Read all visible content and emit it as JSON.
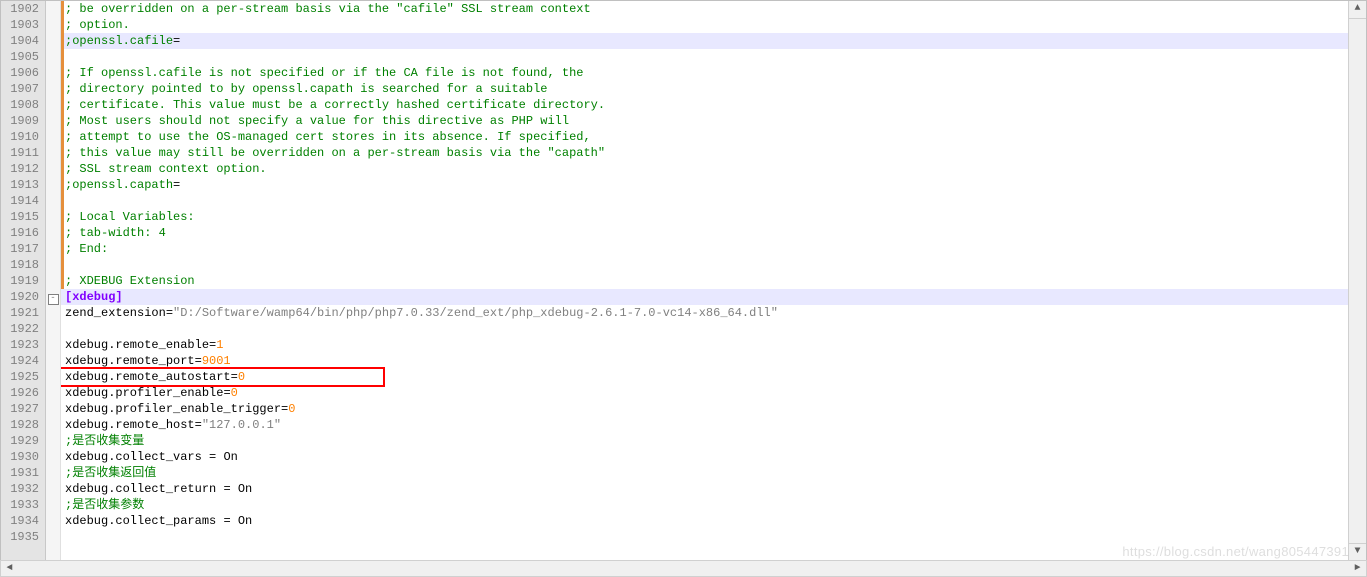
{
  "gutter_start": 1902,
  "lines": [
    {
      "n": 1902,
      "type": "comment",
      "text": "; be overridden on a per-stream basis via the \"cafile\" SSL stream context",
      "orange": true
    },
    {
      "n": 1903,
      "type": "comment",
      "text": "; option.",
      "orange": true
    },
    {
      "n": 1904,
      "type": "raw",
      "html": "<span class='comment'>;openssl.cafile</span><span class='op'>=</span>",
      "hl": true,
      "orange": true
    },
    {
      "n": 1905,
      "type": "blank",
      "text": "",
      "orange": true
    },
    {
      "n": 1906,
      "type": "comment",
      "text": "; If openssl.cafile is not specified or if the CA file is not found, the",
      "orange": true
    },
    {
      "n": 1907,
      "type": "comment",
      "text": "; directory pointed to by openssl.capath is searched for a suitable",
      "orange": true
    },
    {
      "n": 1908,
      "type": "comment",
      "text": "; certificate. This value must be a correctly hashed certificate directory.",
      "orange": true
    },
    {
      "n": 1909,
      "type": "comment",
      "text": "; Most users should not specify a value for this directive as PHP will",
      "orange": true
    },
    {
      "n": 1910,
      "type": "comment",
      "text": "; attempt to use the OS-managed cert stores in its absence. If specified,",
      "orange": true
    },
    {
      "n": 1911,
      "type": "comment",
      "text": "; this value may still be overridden on a per-stream basis via the \"capath\"",
      "orange": true
    },
    {
      "n": 1912,
      "type": "comment",
      "text": "; SSL stream context option.",
      "orange": true
    },
    {
      "n": 1913,
      "type": "raw",
      "html": "<span class='comment'>;openssl.capath</span><span class='op'>=</span>",
      "orange": true
    },
    {
      "n": 1914,
      "type": "blank",
      "text": "",
      "orange": true
    },
    {
      "n": 1915,
      "type": "comment",
      "text": "; Local Variables:",
      "orange": true
    },
    {
      "n": 1916,
      "type": "comment",
      "text": "; tab-width: 4",
      "orange": true
    },
    {
      "n": 1917,
      "type": "comment",
      "text": "; End:",
      "orange": true
    },
    {
      "n": 1918,
      "type": "blank",
      "text": "",
      "orange": true
    },
    {
      "n": 1919,
      "type": "comment",
      "text": "; XDEBUG Extension",
      "orange": true
    },
    {
      "n": 1920,
      "type": "raw",
      "html": "<span class='section'>[xdebug]</span>",
      "fold": true,
      "hl": true
    },
    {
      "n": 1921,
      "type": "raw",
      "html": "<span class='key'>zend_extension</span><span class='op'>=</span><span class='str'>\"D:/Software/wamp64/bin/php/php7.0.33/zend_ext/php_xdebug-2.6.1-7.0-vc14-x86_64.dll\"</span>"
    },
    {
      "n": 1922,
      "type": "blank",
      "text": ""
    },
    {
      "n": 1923,
      "type": "raw",
      "html": "<span class='key'>xdebug.remote_enable</span><span class='op'>=</span><span class='num'>1</span>"
    },
    {
      "n": 1924,
      "type": "raw",
      "html": "<span class='key'>xdebug.remote_port</span><span class='op'>=</span><span class='num'>9001</span>"
    },
    {
      "n": 1925,
      "type": "raw",
      "html": "<span class='key'>xdebug.remote_autostart</span><span class='op'>=</span><span class='num'>0</span>"
    },
    {
      "n": 1926,
      "type": "raw",
      "html": "<span class='key'>xdebug.profiler_enable</span><span class='op'>=</span><span class='num'>0</span>"
    },
    {
      "n": 1927,
      "type": "raw",
      "html": "<span class='key'>xdebug.profiler_enable_trigger</span><span class='op'>=</span><span class='num'>0</span>"
    },
    {
      "n": 1928,
      "type": "raw",
      "html": "<span class='key'>xdebug.remote_host</span><span class='op'>=</span><span class='str'>\"127.0.0.1\"</span>"
    },
    {
      "n": 1929,
      "type": "comment",
      "text": ";是否收集变量"
    },
    {
      "n": 1930,
      "type": "raw",
      "html": "<span class='key'>xdebug.collect_vars</span> <span class='op'>=</span> <span class='key'>On</span>"
    },
    {
      "n": 1931,
      "type": "comment",
      "text": ";是否收集返回值"
    },
    {
      "n": 1932,
      "type": "raw",
      "html": "<span class='key'>xdebug.collect_return</span> <span class='op'>=</span> <span class='key'>On</span>"
    },
    {
      "n": 1933,
      "type": "comment",
      "text": ";是否收集参数"
    },
    {
      "n": 1934,
      "type": "raw",
      "html": "<span class='key'>xdebug.collect_params</span> <span class='op'>=</span> <span class='key'>On</span>"
    },
    {
      "n": 1935,
      "type": "blank",
      "text": ""
    }
  ],
  "red_box_line": 1925,
  "scroll": {
    "up": "▲",
    "down": "▼",
    "left": "◄",
    "right": "►"
  },
  "fold_glyph": "-",
  "watermark": "https://blog.csdn.net/wang805447391"
}
